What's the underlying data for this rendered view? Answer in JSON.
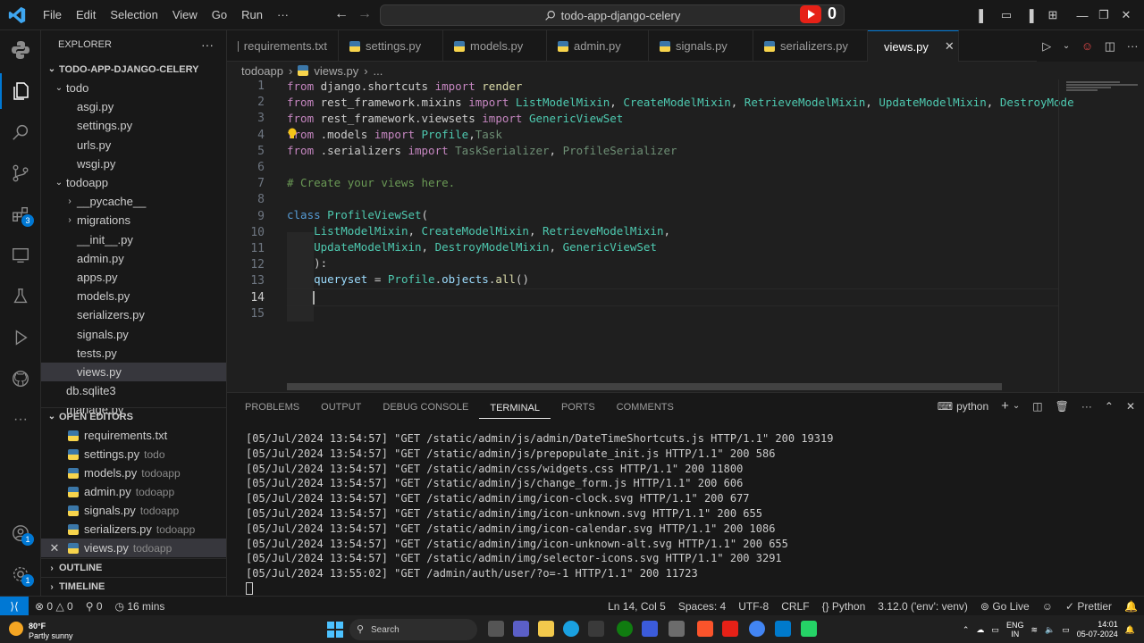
{
  "titlebar": {
    "menu": [
      "File",
      "Edit",
      "Selection",
      "View",
      "Go",
      "Run",
      "···"
    ],
    "search_text": "todo-app-django-celery",
    "counter": "0"
  },
  "activity": {
    "extensions_badge": "3",
    "accounts_badge": "1",
    "settings_badge": "1"
  },
  "sidebar": {
    "explorer_title": "EXPLORER",
    "project": "TODO-APP-DJANGO-CELERY",
    "tree": [
      {
        "label": "todo",
        "type": "folder",
        "indent": 1
      },
      {
        "label": "asgi.py",
        "type": "py",
        "indent": 2
      },
      {
        "label": "settings.py",
        "type": "py",
        "indent": 2
      },
      {
        "label": "urls.py",
        "type": "py",
        "indent": 2
      },
      {
        "label": "wsgi.py",
        "type": "py",
        "indent": 2
      },
      {
        "label": "todoapp",
        "type": "folder",
        "indent": 1
      },
      {
        "label": "__pycache__",
        "type": "folder-closed",
        "indent": 2
      },
      {
        "label": "migrations",
        "type": "folder-closed",
        "indent": 2
      },
      {
        "label": "__init__.py",
        "type": "py",
        "indent": 2
      },
      {
        "label": "admin.py",
        "type": "py",
        "indent": 2
      },
      {
        "label": "apps.py",
        "type": "py",
        "indent": 2
      },
      {
        "label": "models.py",
        "type": "py",
        "indent": 2
      },
      {
        "label": "serializers.py",
        "type": "py",
        "indent": 2
      },
      {
        "label": "signals.py",
        "type": "py",
        "indent": 2
      },
      {
        "label": "tests.py",
        "type": "py",
        "indent": 2
      },
      {
        "label": "views.py",
        "type": "py",
        "indent": 2,
        "selected": true
      },
      {
        "label": "db.sqlite3",
        "type": "db",
        "indent": 1
      },
      {
        "label": "manage.py",
        "type": "py",
        "indent": 1
      }
    ],
    "open_editors_title": "OPEN EDITORS",
    "open_editors": [
      {
        "label": "requirements.txt",
        "desc": ""
      },
      {
        "label": "settings.py",
        "desc": "todo"
      },
      {
        "label": "models.py",
        "desc": "todoapp"
      },
      {
        "label": "admin.py",
        "desc": "todoapp"
      },
      {
        "label": "signals.py",
        "desc": "todoapp"
      },
      {
        "label": "serializers.py",
        "desc": "todoapp"
      },
      {
        "label": "views.py",
        "desc": "todoapp"
      }
    ],
    "outline_title": "OUTLINE",
    "timeline_title": "TIMELINE"
  },
  "tabs": [
    "requirements.txt",
    "settings.py",
    "models.py",
    "admin.py",
    "signals.py",
    "serializers.py",
    "views.py"
  ],
  "active_tab": "views.py",
  "breadcrumb": [
    "todoapp",
    "views.py",
    "..."
  ],
  "editor": {
    "line_numbers": [
      "1",
      "2",
      "3",
      "4",
      "5",
      "6",
      "7",
      "8",
      "9",
      "10",
      "11",
      "12",
      "13",
      "14",
      "15"
    ],
    "current_line": "14"
  },
  "panel": {
    "tabs": [
      "PROBLEMS",
      "OUTPUT",
      "DEBUG CONSOLE",
      "TERMINAL",
      "PORTS",
      "COMMENTS"
    ],
    "active_tab": "TERMINAL",
    "terminal_name": "python",
    "lines": [
      "[05/Jul/2024 13:54:57] \"GET /static/admin/js/admin/DateTimeShortcuts.js HTTP/1.1\" 200 19319",
      "[05/Jul/2024 13:54:57] \"GET /static/admin/js/prepopulate_init.js HTTP/1.1\" 200 586",
      "[05/Jul/2024 13:54:57] \"GET /static/admin/css/widgets.css HTTP/1.1\" 200 11800",
      "[05/Jul/2024 13:54:57] \"GET /static/admin/js/change_form.js HTTP/1.1\" 200 606",
      "[05/Jul/2024 13:54:57] \"GET /static/admin/img/icon-clock.svg HTTP/1.1\" 200 677",
      "[05/Jul/2024 13:54:57] \"GET /static/admin/img/icon-unknown.svg HTTP/1.1\" 200 655",
      "[05/Jul/2024 13:54:57] \"GET /static/admin/img/icon-calendar.svg HTTP/1.1\" 200 1086",
      "[05/Jul/2024 13:54:57] \"GET /static/admin/img/icon-unknown-alt.svg HTTP/1.1\" 200 655",
      "[05/Jul/2024 13:54:57] \"GET /static/admin/img/selector-icons.svg HTTP/1.1\" 200 3291",
      "[05/Jul/2024 13:55:02] \"GET /admin/auth/user/?o=-1 HTTP/1.1\" 200 11723"
    ]
  },
  "statusbar": {
    "errors": "0",
    "warnings": "0",
    "info": "0",
    "time": "16 mins",
    "position": "Ln 14, Col 5",
    "spaces": "Spaces: 4",
    "encoding": "UTF-8",
    "eol": "CRLF",
    "language": "Python",
    "interpreter": "3.12.0 ('env': venv)",
    "golive": "Go Live",
    "prettier": "Prettier"
  },
  "taskbar": {
    "temp": "80°F",
    "weather": "Partly sunny",
    "search": "Search",
    "lang": "ENG",
    "region": "IN",
    "clock": "14:01",
    "date": "05-07-2024"
  },
  "colors": {
    "accent": "#0078d4",
    "keyword": "#c586c0",
    "class": "#4ec9b0",
    "comment": "#6a9955"
  }
}
